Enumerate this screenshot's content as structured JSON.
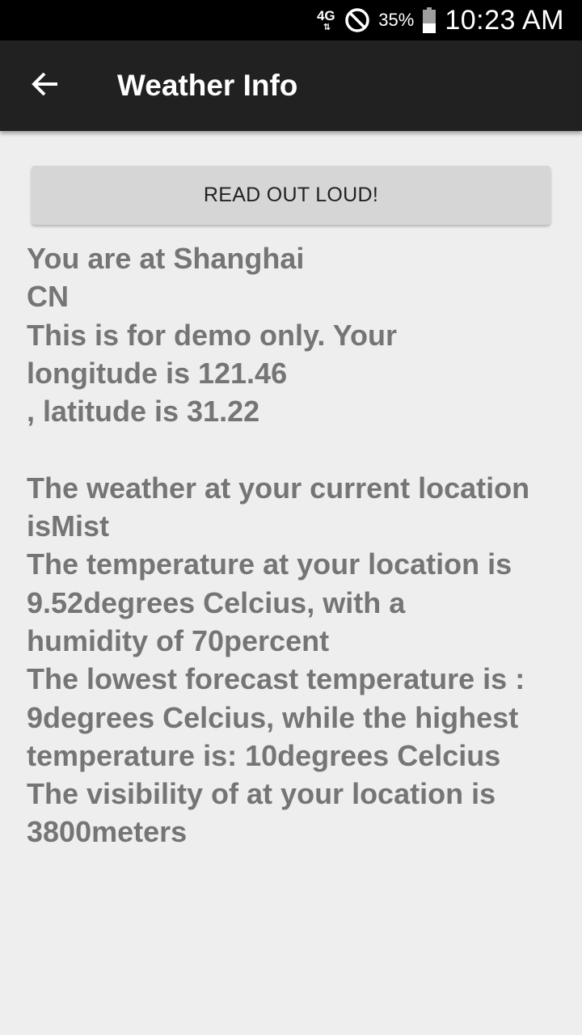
{
  "status_bar": {
    "network": "4G",
    "battery_percent": "35%",
    "time": "10:23 AM",
    "icons": [
      "network-4g-icon",
      "do-not-disturb-icon",
      "battery-icon"
    ]
  },
  "app_bar": {
    "title": "Weather Info",
    "back_icon": "arrow-back-icon",
    "background": "#212121"
  },
  "read_button": {
    "label": "READ OUT LOUD!"
  },
  "info": {
    "location_line": "You are at Shanghai",
    "country_line": "CN",
    "demo_line_1": "This is for demo only. Your",
    "demo_line_2": "longitude is 121.46",
    "demo_line_3": ", latitude is 31.22",
    "weather_line_1": "The weather at your current location",
    "weather_line_2": "isMist",
    "temp_line_1": "The temperature at your location is",
    "temp_line_2": "9.52degrees Celcius, with a",
    "temp_line_3": "humidity of 70percent",
    "forecast_line_1": "The lowest forecast temperature is :",
    "forecast_line_2": "9degrees Celcius, while the highest",
    "forecast_line_3": "temperature is: 10degrees Celcius",
    "visibility_line_1": "The visibility of at your location is",
    "visibility_line_2": "3800meters"
  },
  "colors": {
    "background": "#eeeeee",
    "text": "#757575",
    "button": "#d6d6d6"
  }
}
